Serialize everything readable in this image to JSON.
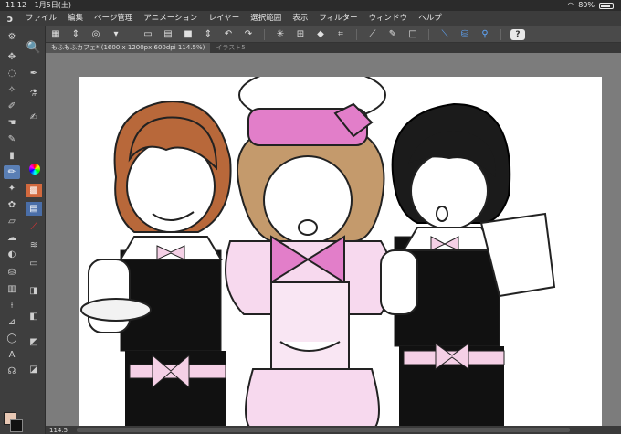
{
  "status_bar": {
    "time": "11:12",
    "date": "1月5日(土)",
    "battery": "80%"
  },
  "menu": {
    "items": [
      "ファイル",
      "編集",
      "ページ管理",
      "アニメーション",
      "レイヤー",
      "選択範囲",
      "表示",
      "フィルター",
      "ウィンドウ",
      "ヘルプ"
    ]
  },
  "toolbar": {
    "help_label": "?"
  },
  "tabs": {
    "active": "もふもふカフェ* (1600 x 1200px 600dpi 114.5%)",
    "inactive": "イラスト5"
  },
  "footer": {
    "zoom": "114.5"
  },
  "colors": {
    "main": "#e8c8b4",
    "sub": "#111111"
  }
}
